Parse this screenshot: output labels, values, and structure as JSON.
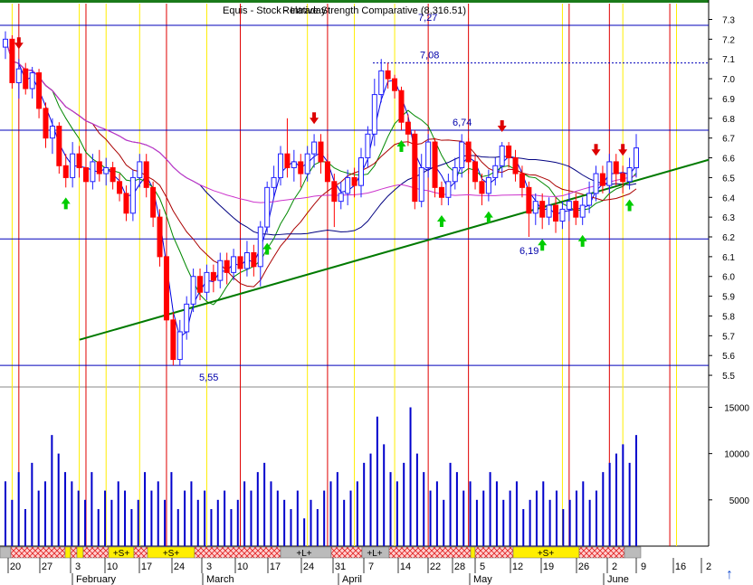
{
  "chart_data": {
    "type": "candlestick",
    "title": "Equis - Stock - Intraday",
    "title_overlay": "Relative Strength Comparative  (8,316.51)",
    "price_axis": {
      "ylim": [
        5.45,
        7.38
      ],
      "ticks": [
        "7.3",
        "7.2",
        "7.1",
        "7.0",
        "6.9",
        "6.8",
        "6.7",
        "6.6",
        "6.5",
        "6.4",
        "6.3",
        "6.2",
        "6.1",
        "6.0",
        "5.9",
        "5.8",
        "5.7",
        "5.6",
        "5.5"
      ]
    },
    "volume_axis": {
      "ylim": [
        0,
        17000
      ],
      "ticks": [
        "15000",
        "10000",
        "5000"
      ]
    },
    "x_ticks": [
      "20",
      "27",
      "3",
      "10",
      "17",
      "24",
      "3",
      "10",
      "17",
      "24",
      "31",
      "7",
      "14",
      "22",
      "28",
      "5",
      "12",
      "19",
      "26",
      "2",
      "9",
      "16",
      "2"
    ],
    "months": [
      "February",
      "March",
      "April",
      "May",
      "June"
    ],
    "level_lines": [
      {
        "value": 7.27,
        "label": "7,27",
        "style": "solid"
      },
      {
        "value": 7.08,
        "label": "7,08",
        "style": "dotted"
      },
      {
        "value": 6.74,
        "label": "6,74",
        "style": "solid"
      },
      {
        "value": 6.19,
        "label": "6,19",
        "style": "solid"
      },
      {
        "value": 5.55,
        "label": "5,55",
        "style": "solid"
      }
    ],
    "trend_line": {
      "from": [
        0,
        5.68
      ],
      "to": [
        96,
        6.59
      ],
      "color": "#007a00"
    },
    "candles": [
      [
        7.16,
        7.2,
        7.24,
        7.1
      ],
      [
        7.2,
        6.98,
        7.22,
        6.95
      ],
      [
        6.98,
        7.05,
        7.1,
        6.9
      ],
      [
        7.05,
        6.95,
        7.08,
        6.92
      ],
      [
        6.95,
        7.03,
        7.06,
        6.9
      ],
      [
        7.03,
        6.85,
        7.05,
        6.8
      ],
      [
        6.85,
        6.7,
        6.88,
        6.65
      ],
      [
        6.7,
        6.76,
        6.8,
        6.62
      ],
      [
        6.76,
        6.56,
        6.78,
        6.52
      ],
      [
        6.56,
        6.5,
        6.62,
        6.45
      ],
      [
        6.5,
        6.62,
        6.68,
        6.45
      ],
      [
        6.62,
        6.55,
        6.66,
        6.5
      ],
      [
        6.55,
        6.48,
        6.62,
        6.44
      ],
      [
        6.48,
        6.58,
        6.62,
        6.44
      ],
      [
        6.58,
        6.52,
        6.64,
        6.48
      ],
      [
        6.52,
        6.55,
        6.6,
        6.46
      ],
      [
        6.55,
        6.48,
        6.58,
        6.44
      ],
      [
        6.48,
        6.42,
        6.52,
        6.38
      ],
      [
        6.42,
        6.32,
        6.46,
        6.28
      ],
      [
        6.32,
        6.5,
        6.54,
        6.28
      ],
      [
        6.5,
        6.58,
        6.62,
        6.45
      ],
      [
        6.58,
        6.45,
        6.62,
        6.4
      ],
      [
        6.45,
        6.3,
        6.48,
        6.25
      ],
      [
        6.3,
        6.1,
        6.34,
        6.05
      ],
      [
        6.1,
        5.78,
        6.14,
        5.74
      ],
      [
        5.78,
        5.58,
        5.82,
        5.55
      ],
      [
        5.58,
        5.72,
        5.78,
        5.55
      ],
      [
        5.72,
        5.86,
        5.9,
        5.68
      ],
      [
        5.86,
        6.0,
        6.04,
        5.82
      ],
      [
        6.0,
        5.92,
        6.04,
        5.88
      ],
      [
        5.92,
        6.02,
        6.06,
        5.88
      ],
      [
        6.02,
        5.98,
        6.06,
        5.92
      ],
      [
        5.98,
        6.08,
        6.12,
        5.94
      ],
      [
        6.08,
        6.02,
        6.12,
        5.96
      ],
      [
        6.02,
        6.1,
        6.14,
        5.98
      ],
      [
        6.1,
        6.04,
        6.14,
        6.0
      ],
      [
        6.04,
        6.12,
        6.18,
        6.0
      ],
      [
        6.12,
        6.05,
        6.16,
        6.0
      ],
      [
        6.05,
        6.25,
        6.28,
        5.95
      ],
      [
        6.25,
        6.45,
        6.48,
        6.22
      ],
      [
        6.45,
        6.5,
        6.56,
        6.4
      ],
      [
        6.5,
        6.62,
        6.66,
        6.46
      ],
      [
        6.62,
        6.55,
        6.8,
        6.5
      ],
      [
        6.55,
        6.58,
        6.64,
        6.48
      ],
      [
        6.58,
        6.52,
        6.62,
        6.45
      ],
      [
        6.52,
        6.62,
        6.66,
        6.48
      ],
      [
        6.62,
        6.68,
        6.72,
        6.55
      ],
      [
        6.68,
        6.58,
        6.72,
        6.52
      ],
      [
        6.58,
        6.48,
        6.62,
        6.44
      ],
      [
        6.48,
        6.38,
        6.52,
        6.25
      ],
      [
        6.38,
        6.42,
        6.48,
        6.34
      ],
      [
        6.42,
        6.5,
        6.54,
        6.36
      ],
      [
        6.5,
        6.46,
        6.55,
        6.4
      ],
      [
        6.46,
        6.6,
        6.65,
        6.4
      ],
      [
        6.6,
        6.72,
        6.76,
        6.55
      ],
      [
        6.72,
        6.92,
        7.0,
        6.66
      ],
      [
        6.92,
        7.04,
        7.1,
        6.88
      ],
      [
        7.04,
        7.0,
        7.08,
        6.95
      ],
      [
        7.0,
        6.94,
        7.02,
        6.9
      ],
      [
        6.94,
        6.78,
        6.96,
        6.74
      ],
      [
        6.78,
        6.72,
        6.82,
        6.66
      ],
      [
        6.72,
        6.38,
        6.74,
        6.34
      ],
      [
        6.38,
        6.55,
        6.62,
        6.35
      ],
      [
        6.55,
        6.68,
        6.72,
        6.5
      ],
      [
        6.68,
        6.45,
        6.7,
        6.4
      ],
      [
        6.45,
        6.4,
        6.48,
        6.36
      ],
      [
        6.4,
        6.48,
        6.52,
        6.36
      ],
      [
        6.48,
        6.55,
        6.6,
        6.44
      ],
      [
        6.55,
        6.68,
        6.72,
        6.5
      ],
      [
        6.68,
        6.58,
        6.7,
        6.52
      ],
      [
        6.58,
        6.48,
        6.62,
        6.44
      ],
      [
        6.48,
        6.42,
        6.52,
        6.36
      ],
      [
        6.42,
        6.5,
        6.54,
        6.38
      ],
      [
        6.5,
        6.56,
        6.6,
        6.46
      ],
      [
        6.56,
        6.66,
        6.68,
        6.5
      ],
      [
        6.66,
        6.6,
        6.68,
        6.55
      ],
      [
        6.6,
        6.52,
        6.64,
        6.48
      ],
      [
        6.52,
        6.45,
        6.56,
        6.4
      ],
      [
        6.45,
        6.32,
        6.48,
        6.2
      ],
      [
        6.32,
        6.38,
        6.42,
        6.26
      ],
      [
        6.38,
        6.3,
        6.42,
        6.24
      ],
      [
        6.3,
        6.36,
        6.4,
        6.26
      ],
      [
        6.36,
        6.28,
        6.4,
        6.22
      ],
      [
        6.28,
        6.34,
        6.38,
        6.24
      ],
      [
        6.34,
        6.38,
        6.42,
        6.28
      ],
      [
        6.38,
        6.3,
        6.42,
        6.26
      ],
      [
        6.3,
        6.36,
        6.4,
        6.26
      ],
      [
        6.36,
        6.42,
        6.48,
        6.32
      ],
      [
        6.42,
        6.52,
        6.56,
        6.38
      ],
      [
        6.52,
        6.46,
        6.56,
        6.42
      ],
      [
        6.46,
        6.58,
        6.62,
        6.42
      ],
      [
        6.58,
        6.52,
        6.62,
        6.46
      ],
      [
        6.52,
        6.48,
        6.56,
        6.42
      ],
      [
        6.48,
        6.55,
        6.6,
        6.44
      ],
      [
        6.55,
        6.65,
        6.72,
        6.5
      ]
    ],
    "volume": [
      7000,
      5000,
      8000,
      4000,
      9000,
      6000,
      7000,
      12000,
      10000,
      8000,
      7000,
      6000,
      5000,
      8000,
      4000,
      6000,
      5000,
      7000,
      6000,
      4000,
      5000,
      8000,
      6000,
      7000,
      5000,
      8000,
      4000,
      6000,
      7000,
      5000,
      6000,
      4000,
      5000,
      6000,
      4000,
      5000,
      7000,
      6000,
      8000,
      9000,
      7000,
      6000,
      5000,
      4000,
      6000,
      3000,
      5000,
      4000,
      6000,
      7000,
      8000,
      5000,
      6000,
      7000,
      9000,
      10000,
      14000,
      11000,
      8000,
      7000,
      9000,
      15000,
      10000,
      8000,
      6000,
      7000,
      5000,
      9000,
      8000,
      6000,
      7000,
      5000,
      6000,
      8000,
      7000,
      5000,
      6000,
      7000,
      4000,
      5000,
      6000,
      7000,
      5000,
      6000,
      4000,
      5000,
      6000,
      7000,
      5000,
      6000,
      8000,
      9000,
      10000,
      11000,
      9000,
      12000
    ],
    "signals": {
      "buy": [
        9,
        39,
        59,
        65,
        72,
        80,
        86,
        93,
        99
      ],
      "sell": [
        2,
        46,
        74,
        88,
        92,
        98,
        107
      ]
    },
    "colors": {
      "up": "#2020ff",
      "down": "#ff0000",
      "bg": "#ffffff",
      "level": "#0000bb",
      "trend": "#007a00"
    }
  },
  "labels": {
    "copyright": "Equis - Stock",
    "up_arrow": "↑"
  }
}
